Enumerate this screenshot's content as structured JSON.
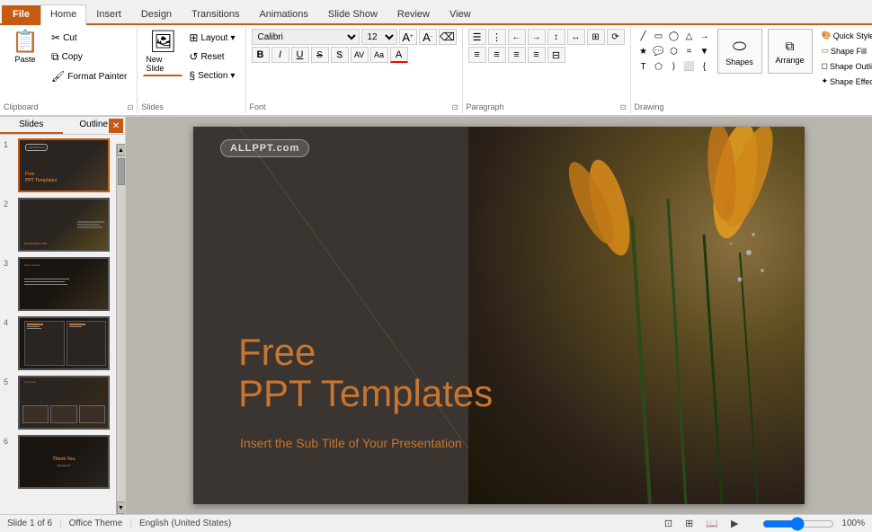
{
  "tabs": [
    {
      "id": "file",
      "label": "File",
      "active": false,
      "file": true
    },
    {
      "id": "home",
      "label": "Home",
      "active": true
    },
    {
      "id": "insert",
      "label": "Insert"
    },
    {
      "id": "design",
      "label": "Design"
    },
    {
      "id": "transitions",
      "label": "Transitions"
    },
    {
      "id": "animations",
      "label": "Animations"
    },
    {
      "id": "slideshow",
      "label": "Slide Show"
    },
    {
      "id": "review",
      "label": "Review"
    },
    {
      "id": "view",
      "label": "View"
    }
  ],
  "clipboard": {
    "label": "Clipboard",
    "paste_label": "Paste",
    "cut_label": "Cut",
    "copy_label": "Copy",
    "format_painter_label": "Format Painter"
  },
  "slides_group": {
    "label": "Slides",
    "new_slide_label": "New Slide",
    "layout_label": "Layout",
    "reset_label": "Reset",
    "section_label": "Section"
  },
  "font_group": {
    "label": "Font",
    "font_name": "Calibri",
    "font_size": "12",
    "bold_label": "B",
    "italic_label": "I",
    "underline_label": "U",
    "strikethrough_label": "S",
    "shadow_label": "S",
    "spacing_label": "A≡",
    "case_label": "Aa",
    "color_label": "A"
  },
  "paragraph_group": {
    "label": "Paragraph",
    "bullets_label": "≡",
    "numbering_label": "≡",
    "decrease_indent": "←",
    "increase_indent": "→",
    "line_spacing": "↕",
    "text_dir": "↔",
    "align_text": "⊞",
    "convert_smartart": "⟳",
    "align_left": "≡",
    "align_center": "≡",
    "align_right": "≡",
    "justify": "≡",
    "columns": "⊟"
  },
  "drawing_group": {
    "label": "Drawing",
    "arrange_label": "Arrange",
    "quick_styles_label": "Quick Styles",
    "shape_fill_label": "Shape Fill",
    "shape_outline_label": "Shape Outline",
    "shape_effects_label": "Shape Effects"
  },
  "slide_panel": {
    "tabs": [
      {
        "label": "Slides",
        "active": true
      },
      {
        "label": "Outline",
        "active": false
      }
    ]
  },
  "slide_thumbnails": [
    {
      "num": 1,
      "selected": true
    },
    {
      "num": 2
    },
    {
      "num": 3
    },
    {
      "num": 4
    },
    {
      "num": 5
    },
    {
      "num": 6
    }
  ],
  "main_slide": {
    "watermark": "ALLPPT.com",
    "title_line1": "Free",
    "title_line2": "PPT Templates",
    "subtitle": "Insert the Sub Title of Your Presentation"
  },
  "status_bar": {
    "slide_info": "Slide 1 of 6",
    "theme": "Office Theme",
    "language": "English (United States)"
  }
}
